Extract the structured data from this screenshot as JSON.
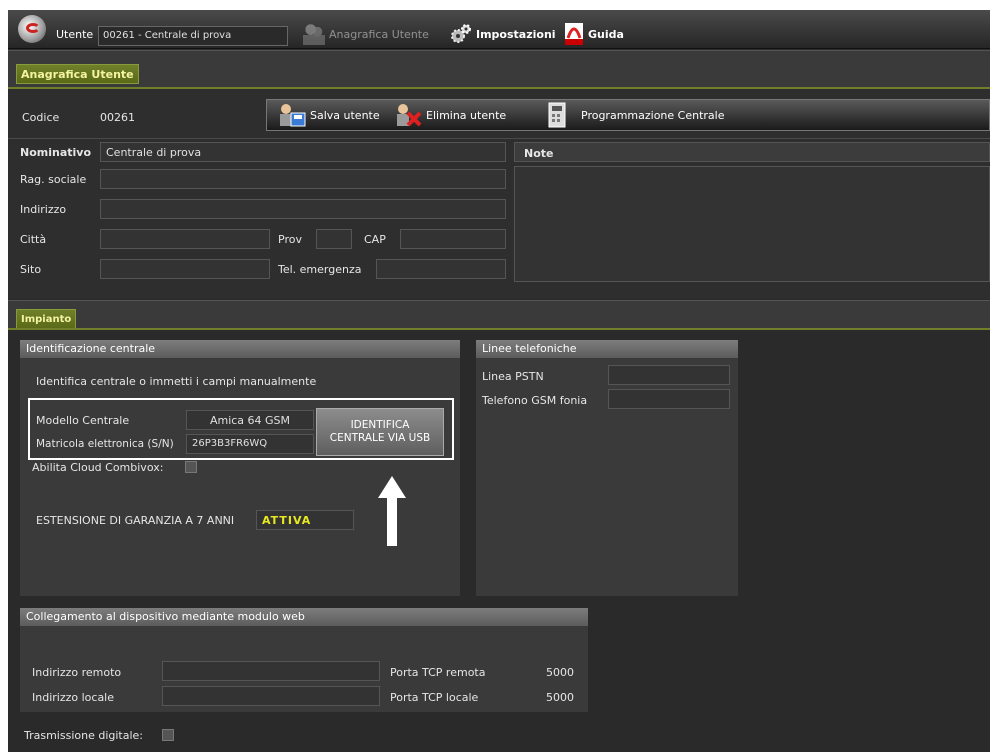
{
  "topbar": {
    "user_label": "Utente",
    "user_value": "00261 - Centrale di prova",
    "anagrafica_label": "Anagrafica Utente",
    "impostazioni_label": "Impostazioni",
    "guida_label": "Guida"
  },
  "tabs": {
    "anagrafica": "Anagrafica Utente",
    "impianto": "Impianto"
  },
  "anagrafica": {
    "codice_label": "Codice",
    "codice_value": "00261",
    "salva_label": "Salva utente",
    "elimina_label": "Elimina utente",
    "programmazione_label": "Programmazione Centrale",
    "nominativo_label": "Nominativo",
    "nominativo_value": "Centrale di prova",
    "rag_sociale_label": "Rag. sociale",
    "indirizzo_label": "Indirizzo",
    "citta_label": "Città",
    "prov_label": "Prov",
    "cap_label": "CAP",
    "sito_label": "Sito",
    "tel_emergenza_label": "Tel. emergenza",
    "note_label": "Note"
  },
  "identificazione": {
    "title": "Identificazione centrale",
    "instructions": "Identifica centrale o immetti i campi manualmente",
    "modello_label": "Modello Centrale",
    "modello_value": "Amica 64 GSM",
    "matricola_label": "Matricola elettronica (S/N)",
    "matricola_value": "26P3B3FR6WQ",
    "identify_button_line1": "IDENTIFICA",
    "identify_button_line2": "CENTRALE VIA USB",
    "cloud_label": "Abilita Cloud Combivox:",
    "garanzia_label": "ESTENSIONE DI GARANZIA A 7 ANNI",
    "garanzia_value": "ATTIVA"
  },
  "linee": {
    "title": "Linee telefoniche",
    "pstn_label": "Linea PSTN",
    "gsm_label": "Telefono GSM fonia"
  },
  "collegamento": {
    "title": "Collegamento al dispositivo mediante modulo web",
    "remoto_label": "Indirizzo remoto",
    "locale_label": "Indirizzo locale",
    "porta_remota_label": "Porta TCP remota",
    "porta_remota_value": "5000",
    "porta_locale_label": "Porta TCP locale",
    "porta_locale_value": "5000"
  },
  "trasmissione_label": "Trasmissione digitale:",
  "colors": {
    "background": "#2b2b2b",
    "tab_green": "#6f7f2a",
    "attiva_text": "#e8e820",
    "highlight_border": "#ffffff"
  }
}
